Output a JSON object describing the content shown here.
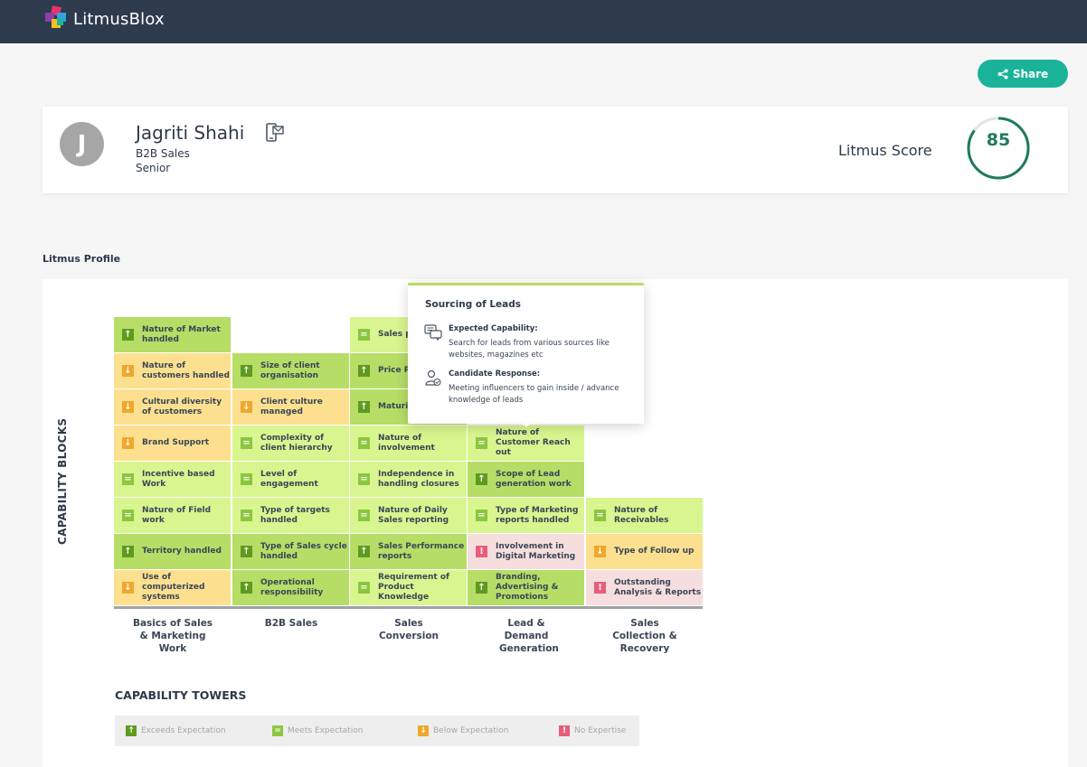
{
  "app": {
    "name": "LitmusBlox"
  },
  "header": {
    "share_label": "Share"
  },
  "profile": {
    "initial": "J",
    "name": "Jagriti Shahi",
    "role": "B2B Sales",
    "level": "Senior",
    "score_label": "Litmus Score",
    "score": "85",
    "score_progress": 0.85
  },
  "section": {
    "title": "Litmus Profile"
  },
  "axes": {
    "blocks_label": "CAPABILITY BLOCKS",
    "towers_label": "CAPABILITY TOWERS"
  },
  "status_colors": {
    "exceeds": {
      "bg": "#b6dd66",
      "icon": "#5f9a1f"
    },
    "meets": {
      "bg": "#d8f58f",
      "icon": "#8cc63f"
    },
    "below": {
      "bg": "#fde08f",
      "icon": "#f0a72b"
    },
    "none": {
      "bg": "#f6dede",
      "icon": "#e85d7a"
    }
  },
  "columns": [
    {
      "label": "Basics of Sales & Marketing Work",
      "cells": [
        {
          "row": 0,
          "label": "Nature of Market handled",
          "status": "exceeds"
        },
        {
          "row": 1,
          "label": "Nature of customers handled",
          "status": "below"
        },
        {
          "row": 2,
          "label": "Cultural diversity of customers",
          "status": "below"
        },
        {
          "row": 3,
          "label": "Brand Support",
          "status": "below"
        },
        {
          "row": 4,
          "label": "Incentive based Work",
          "status": "meets"
        },
        {
          "row": 5,
          "label": "Nature of Field work",
          "status": "meets"
        },
        {
          "row": 6,
          "label": "Territory handled",
          "status": "exceeds"
        },
        {
          "row": 7,
          "label": "Use of computerized systems",
          "status": "below"
        }
      ]
    },
    {
      "label": "B2B Sales",
      "cells": [
        {
          "row": 1,
          "label": "Size of client organisation",
          "status": "exceeds"
        },
        {
          "row": 2,
          "label": "Client culture managed",
          "status": "below"
        },
        {
          "row": 3,
          "label": "Complexity of client hierarchy",
          "status": "meets"
        },
        {
          "row": 4,
          "label": "Level of engagement",
          "status": "meets"
        },
        {
          "row": 5,
          "label": "Type of targets handled",
          "status": "meets"
        },
        {
          "row": 6,
          "label": "Type of Sales cycle handled",
          "status": "exceeds"
        },
        {
          "row": 7,
          "label": "Operational responsibility",
          "status": "exceeds"
        }
      ]
    },
    {
      "label": "Sales Conversion",
      "cells": [
        {
          "row": 0,
          "label": "Sales pi compe",
          "status": "meets"
        },
        {
          "row": 1,
          "label": "Price Pa",
          "status": "exceeds"
        },
        {
          "row": 2,
          "label": "Maturity Materia",
          "status": "exceeds"
        },
        {
          "row": 3,
          "label": "Nature of involvement",
          "status": "meets"
        },
        {
          "row": 4,
          "label": "Independence in handling closures",
          "status": "meets"
        },
        {
          "row": 5,
          "label": "Nature of Daily Sales reporting",
          "status": "meets"
        },
        {
          "row": 6,
          "label": "Sales Performance reports",
          "status": "exceeds"
        },
        {
          "row": 7,
          "label": "Requirement of Product Knowledge",
          "status": "meets"
        }
      ]
    },
    {
      "label": "Lead & Demand Generation",
      "cells": [
        {
          "row": 3,
          "label": "Nature of Customer Reach out",
          "status": "meets"
        },
        {
          "row": 4,
          "label": "Scope of Lead generation work",
          "status": "exceeds"
        },
        {
          "row": 5,
          "label": "Type of Marketing reports handled",
          "status": "meets"
        },
        {
          "row": 6,
          "label": "Involvement in Digital Marketing",
          "status": "none"
        },
        {
          "row": 7,
          "label": "Branding, Advertising & Promotions",
          "status": "exceeds"
        }
      ]
    },
    {
      "label": "Sales Collection & Recovery",
      "cells": [
        {
          "row": 5,
          "label": "Nature of Receivables",
          "status": "meets"
        },
        {
          "row": 6,
          "label": "Type of Follow up",
          "status": "below"
        },
        {
          "row": 7,
          "label": "Outstanding Analysis & Reports",
          "status": "none"
        }
      ]
    }
  ],
  "legend": [
    {
      "label": "Exceeds Expectation",
      "status": "exceeds"
    },
    {
      "label": "Meets Expectation",
      "status": "meets"
    },
    {
      "label": "Below Expectation",
      "status": "below"
    },
    {
      "label": "No Expertise",
      "status": "none"
    }
  ],
  "tooltip": {
    "title": "Sourcing of Leads",
    "expected_heading": "Expected Capability:",
    "expected_text": "Search for leads from various sources like websites, magazines etc",
    "response_heading": "Candidate Response:",
    "response_text": "Meeting influencers to gain inside / advance knowledge of leads"
  }
}
